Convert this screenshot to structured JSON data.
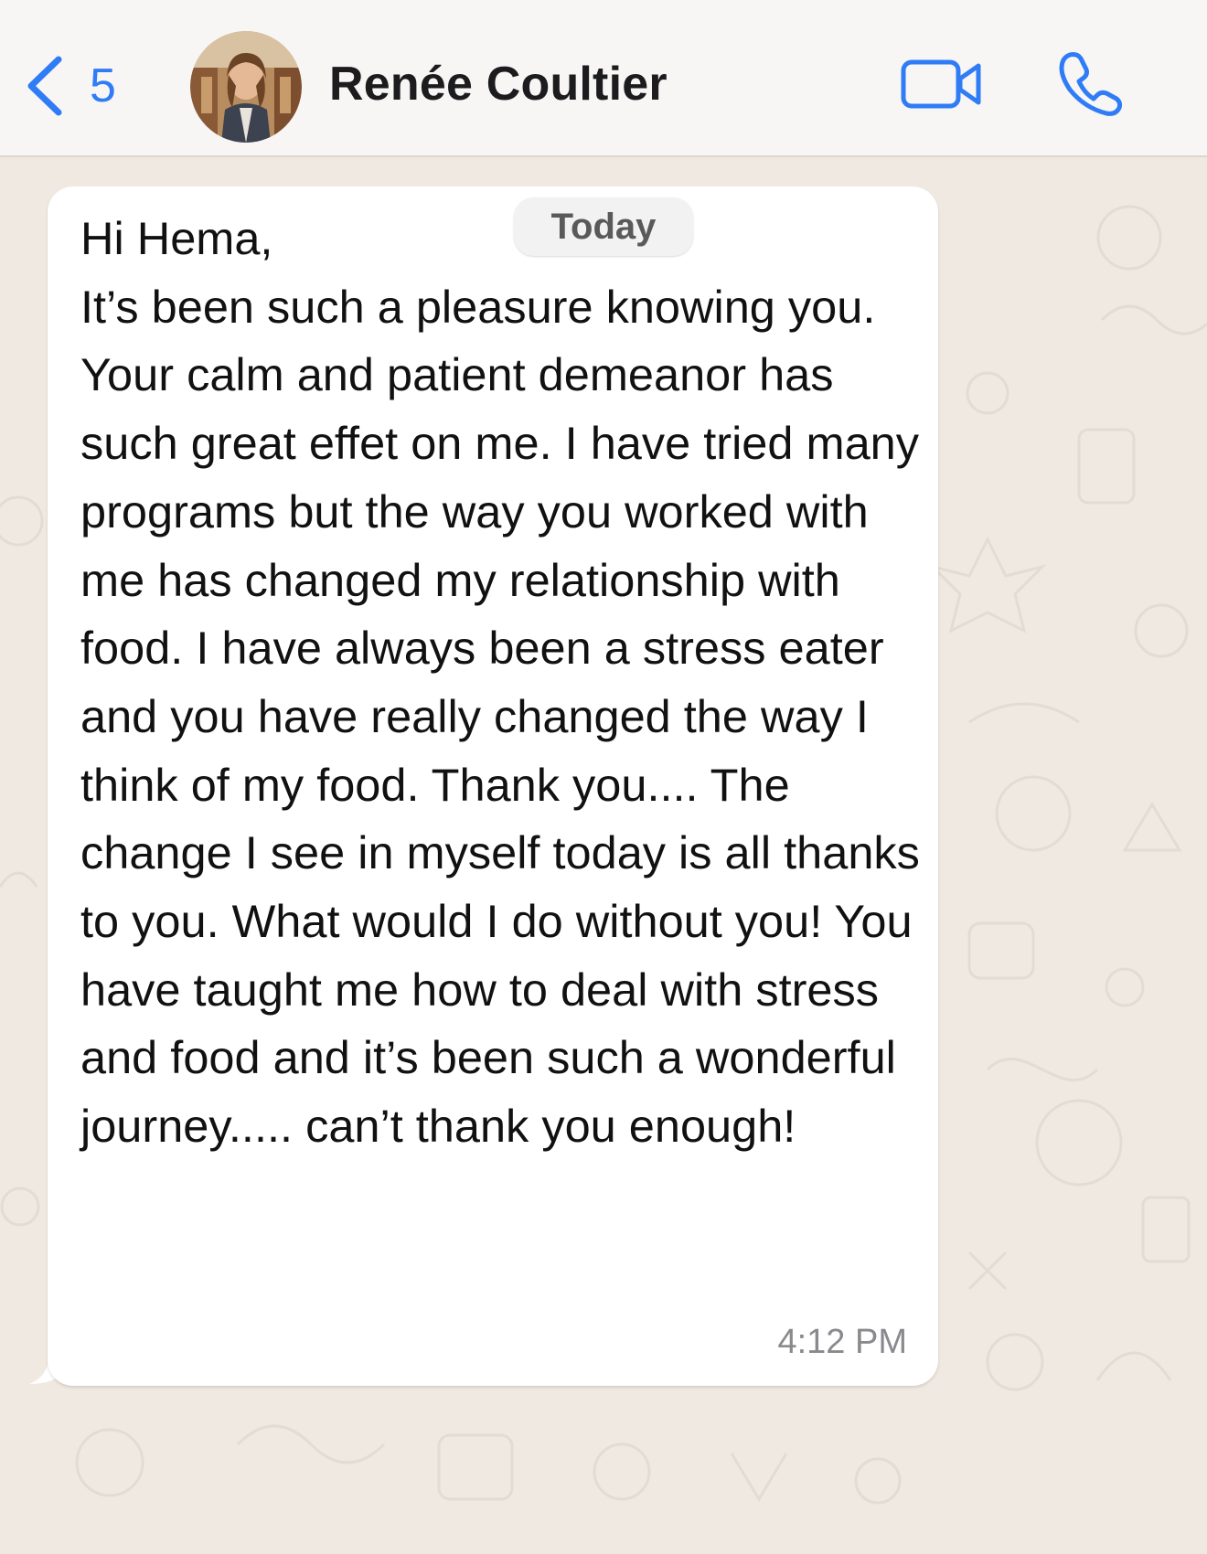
{
  "header": {
    "back_count": "5",
    "contact_name": "Renée Coultier",
    "video_call_icon": "video-camera-icon",
    "voice_call_icon": "phone-icon",
    "accent_color": "#2f7cf6"
  },
  "chat": {
    "date_label": "Today",
    "message": {
      "text": "Hi Hema,\nIt’s been such a pleasure knowing you. Your calm and patient demeanor has such great effet on me. I have tried many programs but the way you worked with me has changed my relationship with food. I have always been a stress eater and you have really changed the way I think of my food. Thank you.... The change I see in myself today is all thanks to you. What would I do without you! You have taught me how to deal with stress and food and it’s been such a wonderful journey..... can’t thank you enough!",
      "time": "4:12 PM"
    }
  }
}
